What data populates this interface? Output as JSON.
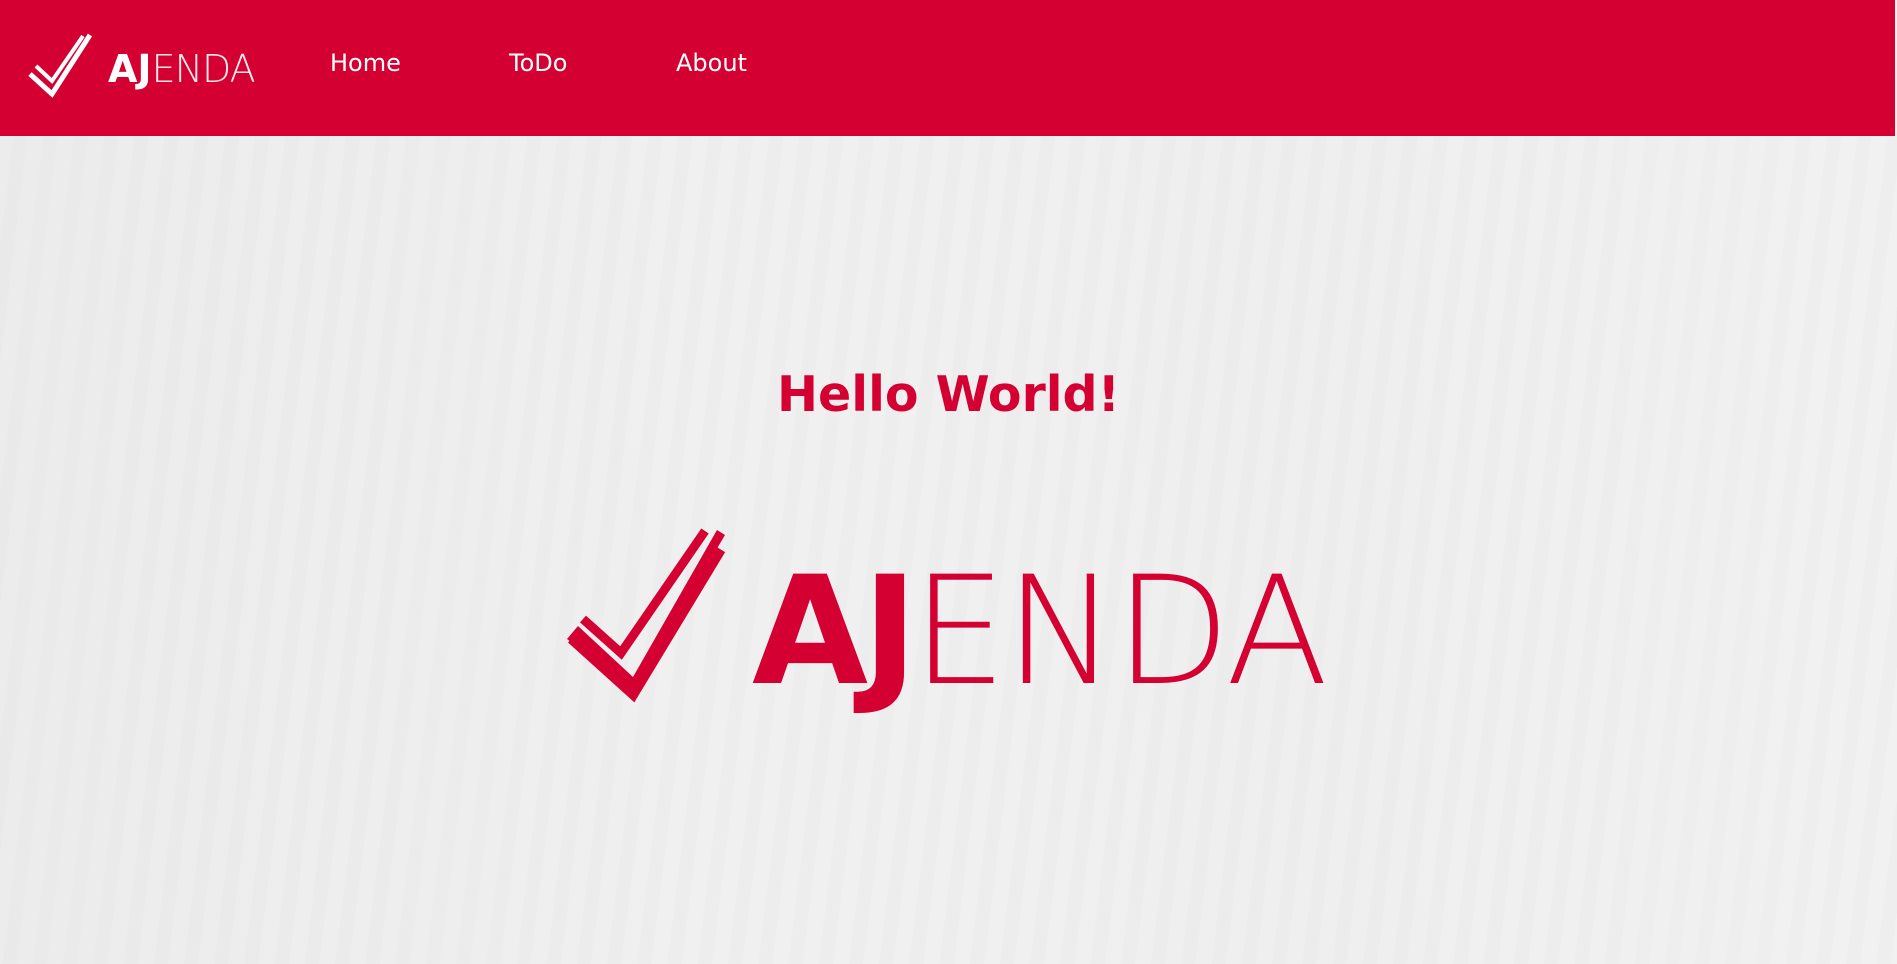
{
  "colors": {
    "brand": "#d30031",
    "nav_text": "#ffffff",
    "background": "#efefef"
  },
  "navbar": {
    "brand": {
      "icon": "checkmark-icon",
      "text_bold": "AJ",
      "text_light": "ENDA"
    },
    "links": [
      {
        "label": "Home"
      },
      {
        "label": "ToDo"
      },
      {
        "label": "About"
      }
    ]
  },
  "main": {
    "heading": "Hello World!",
    "logo": {
      "icon": "checkmark-icon",
      "text_bold": "AJ",
      "text_light": "ENDA"
    }
  }
}
